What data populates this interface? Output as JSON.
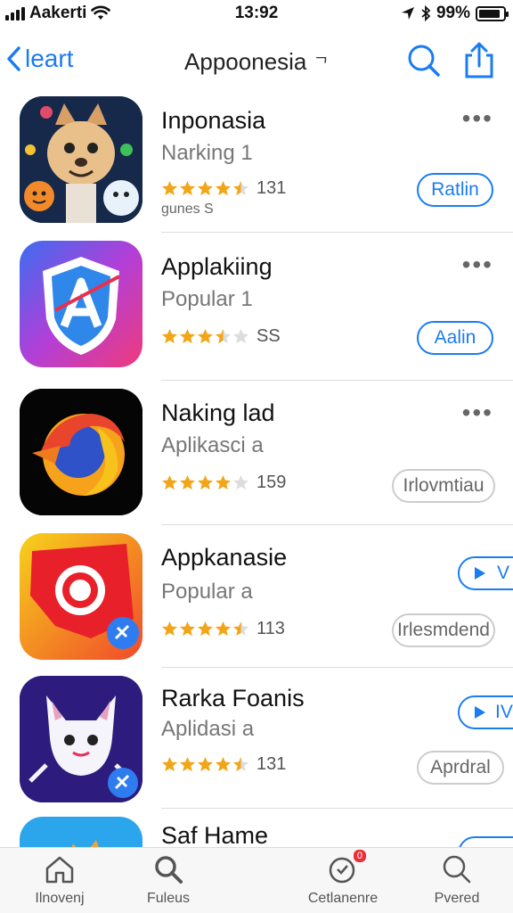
{
  "status_bar": {
    "carrier": "Aakerti",
    "time": "13:92",
    "battery": "99%",
    "battery_level": 0.9
  },
  "nav": {
    "back_label": "leart",
    "title": "Appoonesia",
    "title_suffix": "ᄀ",
    "icons": [
      "search-icon",
      "share-icon"
    ]
  },
  "apps": [
    {
      "name": "Inponasia",
      "subtitle": "Narking 1",
      "rating_stars": 4.5,
      "rating_count": "131",
      "extra": "gunes S",
      "button": "Ratlin",
      "button_style": "blue",
      "more": "•••",
      "icon": "cartoon-fox-icon"
    },
    {
      "name": "Applakiing",
      "subtitle": "Popular 1",
      "rating_stars": 3.5,
      "rating_count": "SS",
      "extra": "",
      "button": "Aalin",
      "button_style": "blue",
      "more": "•••",
      "icon": "shield-a-icon"
    },
    {
      "name": "Naking lad",
      "subtitle": "Aplikasci a",
      "rating_stars": 4,
      "rating_count": "159",
      "extra": "",
      "button": "Irlovmtiau",
      "button_style": "gray",
      "more": "•••",
      "icon": "fire-globe-icon"
    },
    {
      "name": "Appkanasie",
      "subtitle": "Popular a",
      "rating_stars": 4.5,
      "rating_count": "113",
      "extra": "",
      "button": "Irlesmdend",
      "button_style": "gray",
      "more": "",
      "play_button": "V",
      "icon": "red-camera-icon"
    },
    {
      "name": "Rarka Foanis",
      "subtitle": "Aplidasi a",
      "rating_stars": 4.5,
      "rating_count": "131",
      "extra": "",
      "button": "Aprdral",
      "button_style": "gray",
      "more": "",
      "play_button": "IV",
      "icon": "white-cat-icon"
    },
    {
      "name": "Saf Hame",
      "subtitle": "",
      "rating_stars": 0,
      "rating_count": "",
      "extra": "",
      "button": "",
      "button_style": "blue",
      "more": "",
      "icon": "blue-fox-icon"
    }
  ],
  "tabbar": {
    "items": [
      {
        "label": "Ilnovenj",
        "icon": "home-icon"
      },
      {
        "label": "Fuleus",
        "icon": "search-icon"
      },
      {
        "label": "Cetlanenre",
        "icon": "updates-icon",
        "badge": "0"
      },
      {
        "label": "Pvered",
        "icon": "search-icon"
      }
    ]
  },
  "colors": {
    "accent": "#1a7cf2",
    "star": "#f2a516"
  }
}
